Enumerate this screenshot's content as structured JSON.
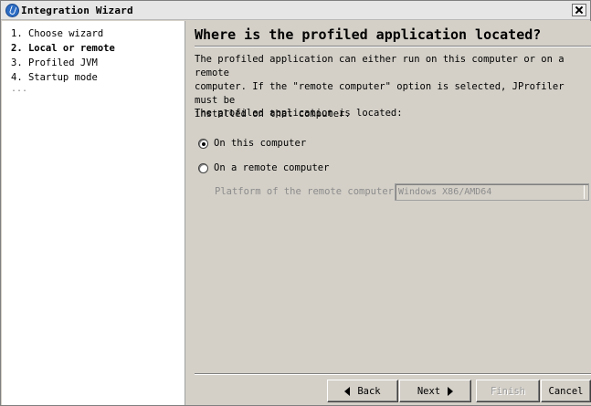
{
  "window": {
    "title": "Integration Wizard"
  },
  "steps": {
    "items": [
      {
        "label": "1. Choose wizard",
        "current": false
      },
      {
        "label": "2. Local or remote",
        "current": true
      },
      {
        "label": "3. Profiled JVM",
        "current": false
      },
      {
        "label": "4. Startup mode",
        "current": false
      }
    ],
    "more": "..."
  },
  "page": {
    "heading": "Where is the profiled application located?",
    "description": "The profiled application can either run on this computer or on a remote\ncomputer. If the \"remote computer\" option is selected, JProfiler must be\ninstalled on that computer.",
    "located_label": "The profiled application is located:",
    "options": [
      {
        "label": "On this computer",
        "selected": true
      },
      {
        "label": "On a remote computer",
        "selected": false
      }
    ],
    "platform_label": "Platform of the remote computer:",
    "platform_value": "Windows X86/AMD64"
  },
  "buttons": {
    "back": "Back",
    "next": "Next",
    "finish": "Finish",
    "cancel": "Cancel"
  }
}
